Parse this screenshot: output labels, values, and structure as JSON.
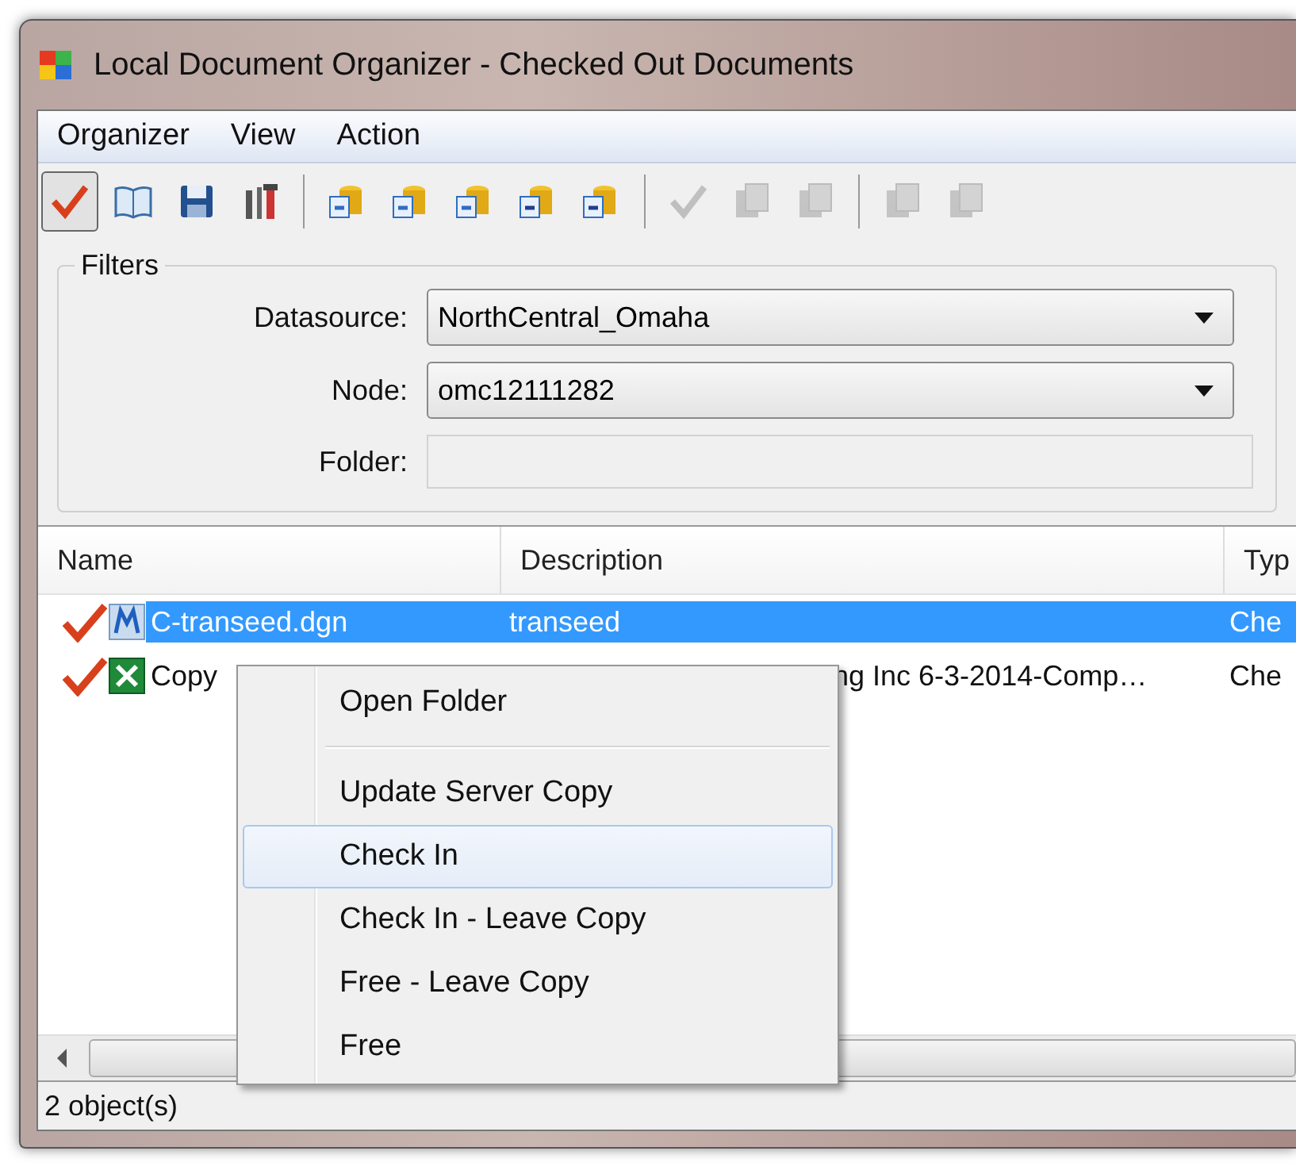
{
  "window": {
    "title": "Local Document Organizer - Checked Out Documents"
  },
  "menu": [
    "Organizer",
    "View",
    "Action"
  ],
  "toolbar": [
    [
      {
        "pressed": true,
        "disabled": false
      },
      {
        "pressed": false,
        "disabled": false
      },
      {
        "pressed": false,
        "disabled": false
      },
      {
        "pressed": false,
        "disabled": false
      }
    ],
    [
      {
        "pressed": false,
        "disabled": false
      },
      {
        "pressed": false,
        "disabled": false
      },
      {
        "pressed": false,
        "disabled": false
      },
      {
        "pressed": false,
        "disabled": false
      },
      {
        "pressed": false,
        "disabled": false
      }
    ],
    [
      {
        "pressed": false,
        "disabled": true
      },
      {
        "pressed": false,
        "disabled": true
      },
      {
        "pressed": false,
        "disabled": true
      }
    ],
    [
      {
        "pressed": false,
        "disabled": true
      },
      {
        "pressed": false,
        "disabled": true
      }
    ]
  ],
  "filters": {
    "title": "Filters",
    "fields": [
      {
        "label": "Datasource:",
        "kind": "combo",
        "value": "NorthCentral_Omaha",
        "disabled": false
      },
      {
        "label": "Node:",
        "kind": "combo",
        "value": "omc12111282",
        "disabled": false
      },
      {
        "label": "Folder:",
        "kind": "text",
        "disabled": true
      }
    ]
  },
  "table": {
    "columns": [
      "Name",
      "Description",
      "Typ"
    ],
    "rows": [
      {
        "selected": true,
        "kind": "drawing",
        "name": "C-transeed.dgn",
        "description": "transeed",
        "type": "Che"
      },
      {
        "selected": false,
        "kind": "spreadsheet",
        "name": "Copy",
        "description": "ng Inc 6-3-2014-Comp…",
        "type": "Che"
      }
    ]
  },
  "context_menu": {
    "items": [
      {
        "kind": "item",
        "label": "Open Folder",
        "selected": false
      },
      {
        "kind": "separator"
      },
      {
        "kind": "item",
        "label": "Update Server Copy",
        "selected": false
      },
      {
        "kind": "item",
        "label": "Check In",
        "selected": true
      },
      {
        "kind": "item",
        "label": "Check In - Leave Copy",
        "selected": false
      },
      {
        "kind": "item",
        "label": "Free - Leave Copy",
        "selected": false
      },
      {
        "kind": "item",
        "label": "Free",
        "selected": false
      }
    ]
  },
  "status_bar": "2 object(s)"
}
